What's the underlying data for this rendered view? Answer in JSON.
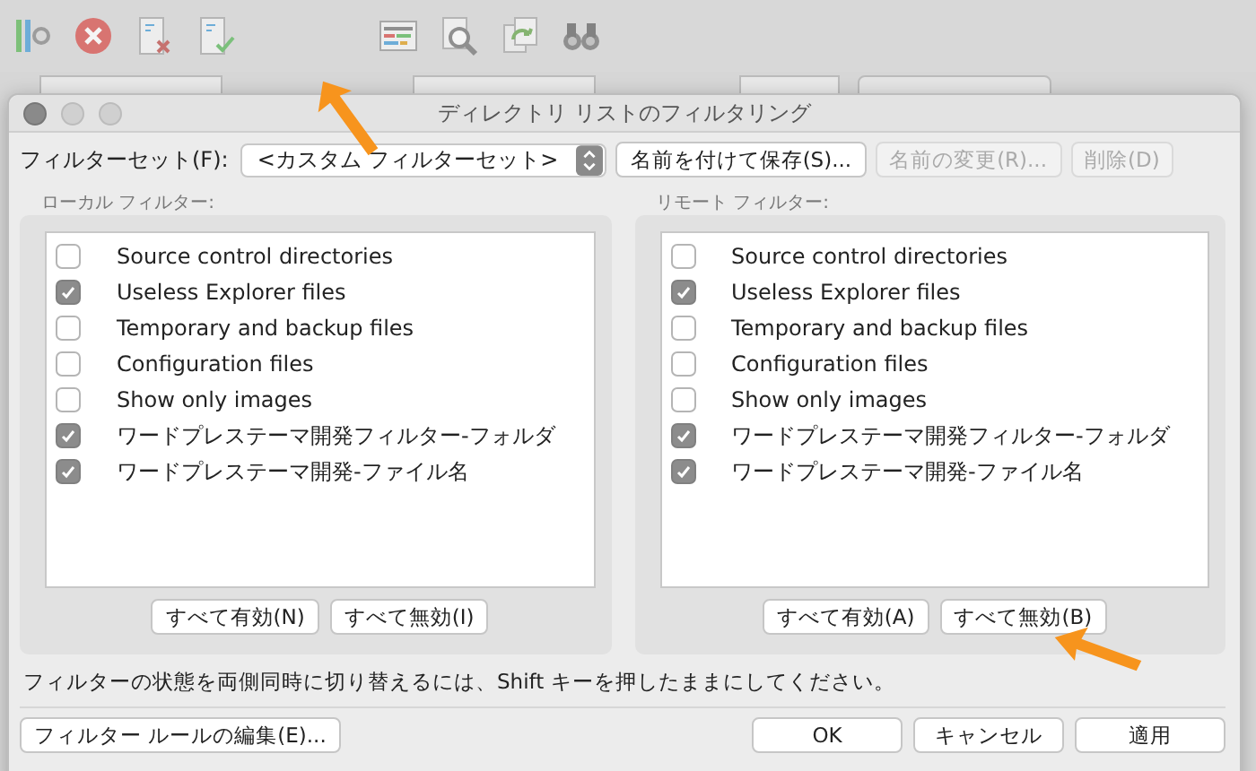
{
  "toolbar": {
    "icons": [
      {
        "kind": "sitemanager"
      },
      {
        "kind": "cancel"
      },
      {
        "kind": "disconnect"
      },
      {
        "kind": "reconnect"
      },
      {
        "kind": "filter"
      },
      {
        "kind": "search"
      },
      {
        "kind": "sync"
      },
      {
        "kind": "binoculars"
      }
    ]
  },
  "dialog": {
    "title": "ディレクトリ リストのフィルタリング",
    "filter_set": {
      "label": "フィルターセット(F):",
      "value": "<カスタム フィルターセット>",
      "buttons": [
        {
          "label": "名前を付けて保存(S)...",
          "disabled": false
        },
        {
          "label": "名前の変更(R)...",
          "disabled": true
        },
        {
          "label": "削除(D)",
          "disabled": true
        }
      ]
    },
    "panels": [
      {
        "label": "ローカル フィルター:",
        "filters": [
          {
            "name": "Source control directories",
            "checked": false
          },
          {
            "name": "Useless Explorer files",
            "checked": true
          },
          {
            "name": "Temporary and backup files",
            "checked": false
          },
          {
            "name": "Configuration files",
            "checked": false
          },
          {
            "name": "Show only images",
            "checked": false
          },
          {
            "name": "ワードプレステーマ開発フィルター-フォルダ",
            "checked": true
          },
          {
            "name": "ワードプレステーマ開発-ファイル名",
            "checked": true
          }
        ],
        "buttons": [
          "すべて有効(N)",
          "すべて無効(I)"
        ]
      },
      {
        "label": "リモート フィルター:",
        "filters": [
          {
            "name": "Source control directories",
            "checked": false
          },
          {
            "name": "Useless Explorer files",
            "checked": true
          },
          {
            "name": "Temporary and backup files",
            "checked": false
          },
          {
            "name": "Configuration files",
            "checked": false
          },
          {
            "name": "Show only images",
            "checked": false
          },
          {
            "name": "ワードプレステーマ開発フィルター-フォルダ",
            "checked": true
          },
          {
            "name": "ワードプレステーマ開発-ファイル名",
            "checked": true
          }
        ],
        "buttons": [
          "すべて有効(A)",
          "すべて無効(B)"
        ]
      }
    ],
    "hint": "フィルターの状態を両側同時に切り替えるには、Shift キーを押したままにしてください。",
    "edit_rules_button": "フィルター ルールの編集(E)...",
    "buttons": [
      "OK",
      "キャンセル",
      "適用"
    ]
  }
}
